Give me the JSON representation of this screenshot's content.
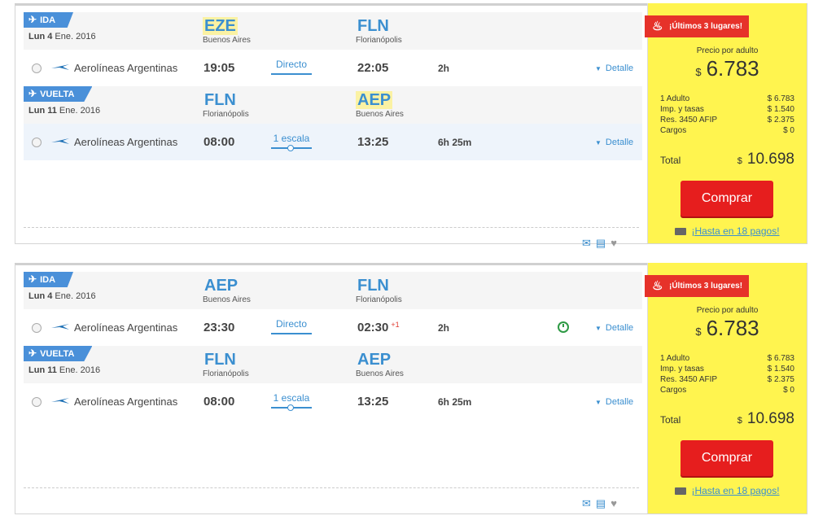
{
  "colors": {
    "accent": "#3b8fd0",
    "tag": "#4a90d9",
    "price_panel": "#fff44f",
    "buy": "#e61e1e",
    "ribbon": "#e6322a"
  },
  "results": [
    {
      "ida": {
        "tag": "IDA",
        "date_day": "Lun 4",
        "date_rest": "Ene. 2016",
        "from_code": "EZE",
        "from_city": "Buenos Aires",
        "to_code": "FLN",
        "to_city": "Florianópolis",
        "airline": "Aerolíneas Argentinas",
        "dep": "19:05",
        "stops": "Directo",
        "arr": "22:05",
        "plus": "",
        "duration": "2h",
        "detalle": "Detalle"
      },
      "vuelta": {
        "tag": "VUELTA",
        "date_day": "Lun 11",
        "date_rest": "Ene. 2016",
        "from_code": "FLN",
        "from_city": "Florianópolis",
        "to_code": "AEP",
        "to_city": "Buenos Aires",
        "airline": "Aerolíneas Argentinas",
        "dep": "08:00",
        "stops": "1 escala",
        "arr": "13:25",
        "duration": "6h 25m",
        "detalle": "Detalle"
      },
      "price": {
        "ribbon": "¡Últimos 3 lugares!",
        "per_adult_label": "Precio por adulto",
        "currency": "$",
        "amount": "6.783",
        "lines": [
          {
            "label": "1 Adulto",
            "value": "$ 6.783"
          },
          {
            "label": "Imp. y tasas",
            "value": "$ 1.540"
          },
          {
            "label": "Res. 3450 AFIP",
            "value": "$ 2.375"
          },
          {
            "label": "Cargos",
            "value": "$ 0"
          }
        ],
        "total_label": "Total",
        "total": "10.698",
        "buy": "Comprar",
        "pay": "¡Hasta en 18 pagos!"
      }
    },
    {
      "ida": {
        "tag": "IDA",
        "date_day": "Lun 4",
        "date_rest": "Ene. 2016",
        "from_code": "AEP",
        "from_city": "Buenos Aires",
        "to_code": "FLN",
        "to_city": "Florianópolis",
        "airline": "Aerolíneas Argentinas",
        "dep": "23:30",
        "stops": "Directo",
        "arr": "02:30",
        "plus": "+1",
        "duration": "2h",
        "detalle": "Detalle"
      },
      "vuelta": {
        "tag": "VUELTA",
        "date_day": "Lun 11",
        "date_rest": "Ene. 2016",
        "from_code": "FLN",
        "from_city": "Florianópolis",
        "to_code": "AEP",
        "to_city": "Buenos Aires",
        "airline": "Aerolíneas Argentinas",
        "dep": "08:00",
        "stops": "1 escala",
        "arr": "13:25",
        "duration": "6h 25m",
        "detalle": "Detalle"
      },
      "price": {
        "ribbon": "¡Últimos 3 lugares!",
        "per_adult_label": "Precio por adulto",
        "currency": "$",
        "amount": "6.783",
        "lines": [
          {
            "label": "1 Adulto",
            "value": "$ 6.783"
          },
          {
            "label": "Imp. y tasas",
            "value": "$ 1.540"
          },
          {
            "label": "Res. 3450 AFIP",
            "value": "$ 2.375"
          },
          {
            "label": "Cargos",
            "value": "$ 0"
          }
        ],
        "total_label": "Total",
        "total": "10.698",
        "buy": "Comprar",
        "pay": "¡Hasta en 18 pagos!"
      }
    }
  ]
}
